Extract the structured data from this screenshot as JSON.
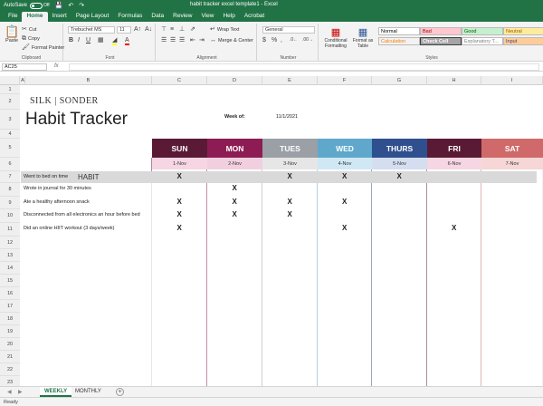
{
  "window": {
    "autosave_label": "AutoSave",
    "autosave_state": "Off",
    "title": "habit tracker excel template1 - Excel"
  },
  "menu": {
    "tabs": [
      "File",
      "Home",
      "Insert",
      "Page Layout",
      "Formulas",
      "Data",
      "Review",
      "View",
      "Help",
      "Acrobat"
    ],
    "active_tab": "Home"
  },
  "ribbon": {
    "clipboard": {
      "paste": "Paste",
      "cut": "Cut",
      "copy": "Copy",
      "format_painter": "Format Painter",
      "label": "Clipboard"
    },
    "font": {
      "name": "Trebuchet MS",
      "size": "11",
      "label": "Font"
    },
    "alignment": {
      "wrap_text": "Wrap Text",
      "merge_center": "Merge & Center",
      "label": "Alignment"
    },
    "number": {
      "format": "General",
      "label": "Number"
    },
    "conditional": "Conditional Formatting",
    "format_table": "Format as Table",
    "styles": {
      "label": "Styles",
      "items": [
        {
          "name": "Normal",
          "bg": "#ffffff",
          "fg": "#000000"
        },
        {
          "name": "Bad",
          "bg": "#ffc7ce",
          "fg": "#9c0006"
        },
        {
          "name": "Good",
          "bg": "#c6efce",
          "fg": "#006100"
        },
        {
          "name": "Neutral",
          "bg": "#ffeb9c",
          "fg": "#9c5700"
        },
        {
          "name": "Calculation",
          "bg": "#f2f2f2",
          "fg": "#fa7d00"
        },
        {
          "name": "Check Cell",
          "bg": "#a5a5a5",
          "fg": "#ffffff"
        },
        {
          "name": "Explanatory T...",
          "bg": "#ffffff",
          "fg": "#7f7f7f"
        },
        {
          "name": "Input",
          "bg": "#ffcc99",
          "fg": "#3f3f76"
        }
      ]
    }
  },
  "formula_bar": {
    "name_box": "AC25",
    "fx": "fx",
    "value": ""
  },
  "columns": [
    "A",
    "B",
    "C",
    "D",
    "E",
    "F",
    "G",
    "H",
    "I"
  ],
  "rows": [
    "1",
    "2",
    "3",
    "4",
    "5",
    "6",
    "7",
    "8",
    "9",
    "10",
    "11",
    "12",
    "13",
    "14",
    "15",
    "16",
    "17",
    "18",
    "19",
    "20",
    "21",
    "22",
    "23"
  ],
  "sheet": {
    "brand": "SILK | SONDER",
    "title": "Habit Tracker",
    "week_of_label": "Week of:",
    "week_of_value": "11/1/2021",
    "habit_header": "HABIT",
    "days": [
      {
        "name": "SUN",
        "date": "1-Nov",
        "color": "#5a1a35",
        "date_bg": "#f5d6e2"
      },
      {
        "name": "MON",
        "date": "2-Nov",
        "color": "#8e1c54",
        "date_bg": "#f2cfdf"
      },
      {
        "name": "TUES",
        "date": "3-Nov",
        "color": "#9aa0a6",
        "date_bg": "#e6e6e6"
      },
      {
        "name": "WED",
        "date": "4-Nov",
        "color": "#5fa8cc",
        "date_bg": "#cfe8f4"
      },
      {
        "name": "THURS",
        "date": "5-Nov",
        "color": "#2f4f8f",
        "date_bg": "#d4def0"
      },
      {
        "name": "FRI",
        "date": "6-Nov",
        "color": "#5a1a35",
        "date_bg": "#f5d6e2"
      },
      {
        "name": "SAT",
        "date": "7-Nov",
        "color": "#d06a6a",
        "date_bg": "#f6d6d6"
      }
    ],
    "habits": [
      {
        "text": "Went to bed on time",
        "marks": [
          "X",
          "",
          "X",
          "X",
          "X",
          "",
          ""
        ]
      },
      {
        "text": "Wrote in journal for 30 minutes",
        "marks": [
          "",
          "X",
          "",
          "",
          "",
          "",
          ""
        ]
      },
      {
        "text": "Ate a healthy afternoon snack",
        "marks": [
          "X",
          "X",
          "X",
          "X",
          "",
          "",
          ""
        ]
      },
      {
        "text": "Disconnected from all electronics an hour before bed",
        "marks": [
          "X",
          "X",
          "X",
          "",
          "",
          "",
          ""
        ]
      },
      {
        "text": "Did an online HIIT workout (3 days/week)",
        "marks": [
          "X",
          "",
          "",
          "X",
          "",
          "X",
          ""
        ]
      }
    ]
  },
  "sheet_tabs": {
    "tabs": [
      "WEEKLY",
      "MONTHLY"
    ],
    "active": "WEEKLY",
    "add": "+"
  },
  "status": {
    "text": "Ready"
  }
}
